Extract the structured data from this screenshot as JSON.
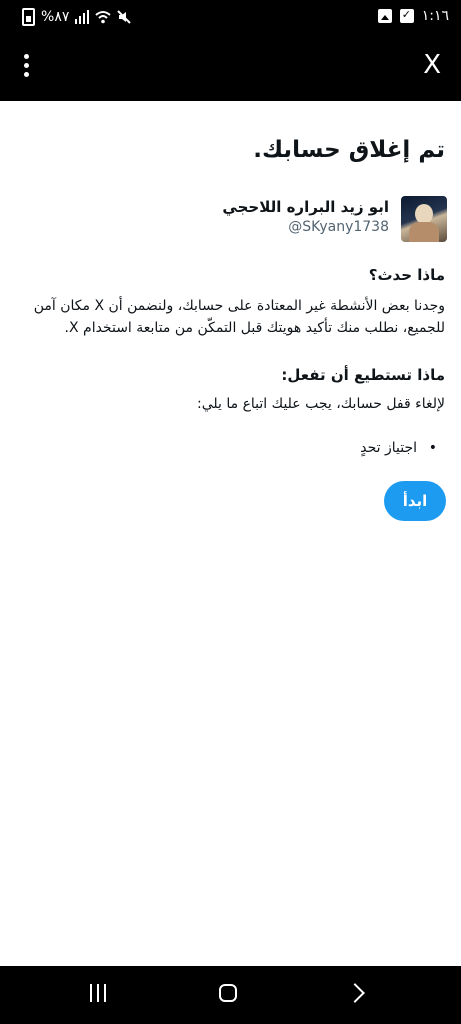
{
  "status_bar": {
    "battery_text": "%٨٧",
    "time": "١:١٦"
  },
  "app_bar": {
    "close_label": "X"
  },
  "page": {
    "title": "تم إغلاق حسابك.",
    "user": {
      "name": "ابو زيد البراره اللاحجي",
      "handle": "@SKyany1738"
    },
    "what_happened_heading": "ماذا حدث؟",
    "what_happened_text": "وجدنا بعض الأنشطة غير المعتادة على حسابك، ولنضمن أن X مكان آمن للجميع، نطلب منك تأكيد هويتك قبل التمكّن من متابعة استخدام X.",
    "what_can_you_do_heading": "ماذا تستطيع أن تفعل:",
    "what_can_you_do_text": "لإلغاء قفل حسابك، يجب عليك اتباع ما يلي:",
    "steps": [
      "اجتياز تحدٍ"
    ],
    "start_button": "ابدأ"
  },
  "colors": {
    "accent": "#1d9bf0",
    "text": "#0f1419",
    "secondary_text": "#536471"
  }
}
